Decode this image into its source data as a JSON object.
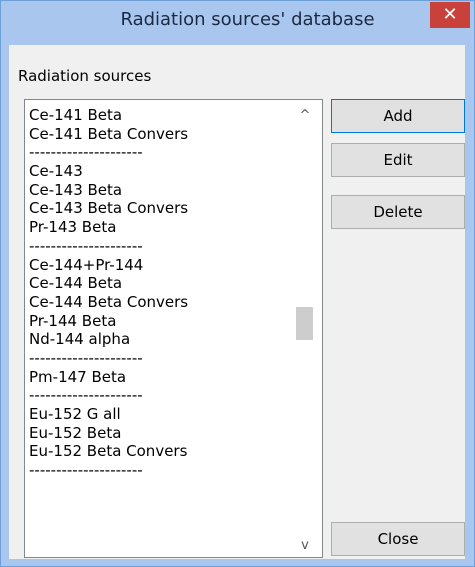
{
  "window": {
    "title": "Radiation sources' database",
    "close_glyph": "✕"
  },
  "group": {
    "label": "Radiation sources"
  },
  "list": {
    "items": [
      "Ce-141 Beta",
      "Ce-141 Beta Convers",
      "---------------------",
      "Ce-143",
      "Ce-143 Beta",
      "Ce-143 Beta Convers",
      "Pr-143 Beta",
      "---------------------",
      "Ce-144+Pr-144",
      "Ce-144 Beta",
      "Ce-144 Beta Convers",
      "Pr-144 Beta",
      "Nd-144 alpha",
      "---------------------",
      "Pm-147 Beta",
      "---------------------",
      "Eu-152 G all",
      "Eu-152 Beta",
      "Eu-152 Beta Convers",
      "---------------------"
    ],
    "scroll_up_glyph": "^",
    "scroll_down_glyph": "v"
  },
  "buttons": {
    "add": "Add",
    "edit": "Edit",
    "delete": "Delete",
    "close": "Close"
  },
  "colors": {
    "titlebar": "#a9c6ee",
    "close_button": "#c8413a",
    "client": "#f0f0f0"
  }
}
